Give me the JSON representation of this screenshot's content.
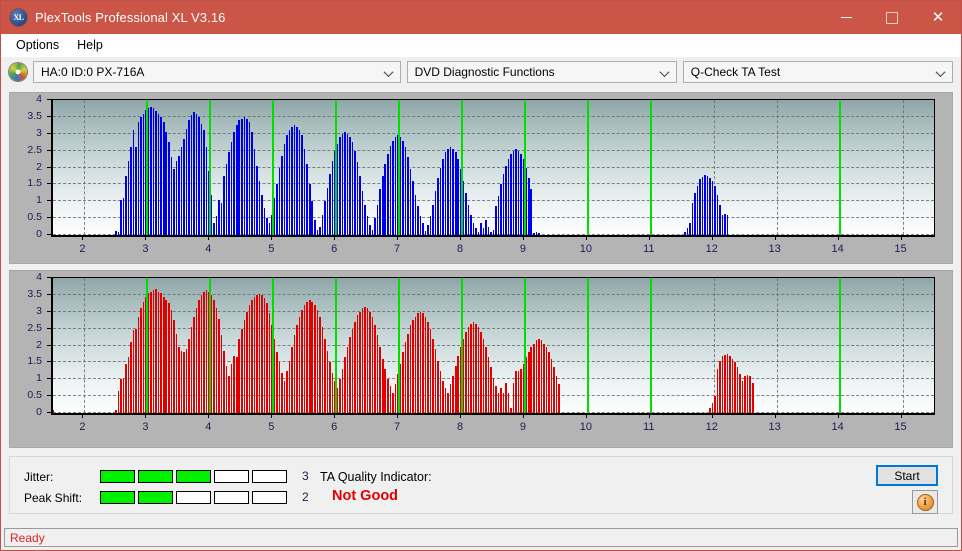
{
  "window": {
    "title": "PlexTools Professional XL V3.16",
    "app_icon": "XL",
    "minimize": "−",
    "maximize": "□",
    "close": "✕"
  },
  "menu": {
    "items": [
      {
        "label": "Options"
      },
      {
        "label": "Help"
      }
    ]
  },
  "toolbar": {
    "drive_icon": "disc-icon",
    "drive": "HA:0 ID:0  PX-716A",
    "function": "DVD Diagnostic Functions",
    "test": "Q-Check TA Test"
  },
  "status": {
    "jitter_label": "Jitter:",
    "jitter_value": "3",
    "jitter_filled": 3,
    "jitter_total": 5,
    "peak_shift_label": "Peak Shift:",
    "peak_shift_value": "2",
    "peak_shift_filled": 2,
    "peak_shift_total": 5,
    "ta_label": "TA Quality Indicator:",
    "ta_value": "Not Good",
    "start_label": "Start",
    "info_glyph": "i",
    "ready": "Ready"
  },
  "colors": {
    "titlebar": "#cb5647",
    "jitter_on": "#00f000",
    "ta_bad": "#e00000",
    "marker": "#00e000",
    "series_top": "#0000e6",
    "series_bottom": "#e00000",
    "accent": "#0078d7"
  },
  "chart_data": [
    {
      "type": "bar",
      "title": "",
      "series_name": "Jitter",
      "color": "#0000e6",
      "xlabel": "",
      "ylabel": "",
      "xlim": [
        1.5,
        15.5
      ],
      "ylim": [
        0,
        4
      ],
      "grid": true,
      "xticks": [
        2,
        3,
        4,
        5,
        6,
        7,
        8,
        9,
        10,
        11,
        12,
        13,
        14,
        15
      ],
      "yticks": [
        0,
        0.5,
        1,
        1.5,
        2,
        2.5,
        3,
        3.5,
        4
      ],
      "markers": [
        3,
        4,
        5,
        6,
        7,
        8,
        9,
        10,
        11,
        14
      ],
      "x_start": 1.5,
      "x_step": 0.04,
      "values": [
        0,
        0,
        0,
        0,
        0,
        0,
        0,
        0,
        0,
        0,
        0,
        0,
        0,
        0,
        0,
        0,
        0,
        0,
        0,
        0,
        0,
        0,
        0,
        0,
        0,
        0.12,
        0.1,
        1.05,
        1.1,
        1.75,
        2.2,
        2.6,
        3.1,
        2.6,
        3.35,
        3.5,
        3.6,
        3.7,
        3.75,
        3.78,
        3.75,
        3.68,
        3.6,
        3.5,
        3.35,
        3.05,
        2.75,
        2.3,
        1.95,
        2.2,
        2.35,
        2.6,
        2.85,
        3.15,
        3.4,
        3.55,
        3.65,
        3.6,
        3.5,
        3.3,
        3.1,
        2.6,
        1.9,
        1.2,
        0.35,
        0.55,
        1.05,
        0.95,
        1.75,
        2.1,
        2.45,
        2.75,
        3.05,
        3.25,
        3.4,
        3.45,
        3.5,
        3.45,
        3.35,
        3.05,
        2.55,
        2.05,
        1.6,
        1.2,
        0.8,
        0.5,
        0.35,
        0.6,
        1.1,
        1.5,
        2.0,
        2.35,
        2.7,
        2.95,
        3.1,
        3.2,
        3.25,
        3.2,
        3.1,
        2.95,
        2.55,
        2.1,
        1.5,
        1.0,
        0.45,
        0.15,
        0.25,
        0.6,
        1.0,
        1.4,
        1.8,
        2.2,
        2.5,
        2.7,
        2.9,
        3.0,
        3.05,
        3.0,
        2.9,
        2.75,
        2.5,
        2.15,
        1.75,
        1.3,
        0.9,
        0.55,
        0.3,
        0.15,
        0.5,
        0.9,
        1.35,
        1.75,
        2.1,
        2.4,
        2.65,
        2.8,
        2.9,
        2.95,
        2.9,
        2.8,
        2.6,
        2.3,
        1.95,
        1.6,
        1.2,
        0.85,
        0.55,
        0.35,
        0.12,
        0.3,
        0.55,
        0.9,
        1.3,
        1.7,
        2.0,
        2.25,
        2.45,
        2.55,
        2.6,
        2.55,
        2.45,
        2.25,
        1.95,
        1.6,
        1.25,
        0.9,
        0.6,
        0.35,
        0.2,
        0.1,
        0.35,
        0.2,
        0.45,
        0.25,
        0.1,
        0.15,
        0.85,
        1.15,
        1.5,
        1.8,
        2.05,
        2.25,
        2.4,
        2.5,
        2.55,
        2.5,
        2.4,
        2.25,
        2.0,
        1.7,
        1.35,
        0.05,
        0.08,
        0.06,
        0,
        0,
        0,
        0,
        0,
        0,
        0,
        0,
        0,
        0,
        0,
        0,
        0,
        0,
        0,
        0,
        0,
        0,
        0,
        0,
        0,
        0,
        0,
        0,
        0,
        0,
        0,
        0,
        0,
        0,
        0,
        0,
        0,
        0,
        0,
        0,
        0,
        0,
        0,
        0,
        0,
        0,
        0,
        0,
        0,
        0,
        0,
        0,
        0,
        0,
        0,
        0,
        0,
        0,
        0,
        0,
        0,
        0.1,
        0.2,
        0.35,
        0.95,
        1.25,
        1.45,
        1.65,
        1.72,
        1.78,
        1.74,
        1.68,
        1.6,
        1.45,
        1.2,
        0.9,
        0.6,
        0.62,
        0.6,
        0,
        0,
        0,
        0,
        0,
        0,
        0,
        0,
        0,
        0,
        0,
        0,
        0,
        0,
        0,
        0,
        0,
        0,
        0,
        0,
        0,
        0,
        0,
        0,
        0,
        0,
        0,
        0,
        0,
        0,
        0,
        0,
        0,
        0,
        0,
        0,
        0,
        0,
        0,
        0,
        0,
        0,
        0,
        0,
        0,
        0,
        0,
        0,
        0,
        0,
        0,
        0,
        0,
        0
      ]
    },
    {
      "type": "bar",
      "title": "",
      "series_name": "Peak Shift",
      "color": "#e00000",
      "xlabel": "",
      "ylabel": "",
      "xlim": [
        1.5,
        15.5
      ],
      "ylim": [
        0,
        4
      ],
      "grid": true,
      "xticks": [
        2,
        3,
        4,
        5,
        6,
        7,
        8,
        9,
        10,
        11,
        12,
        13,
        14,
        15
      ],
      "yticks": [
        0,
        0.5,
        1,
        1.5,
        2,
        2.5,
        3,
        3.5,
        4
      ],
      "markers": [
        3,
        4,
        5,
        6,
        7,
        8,
        9,
        10,
        11,
        14
      ],
      "x_start": 1.5,
      "x_step": 0.04,
      "values": [
        0.08,
        0,
        0,
        0,
        0,
        0,
        0,
        0,
        0,
        0,
        0,
        0,
        0,
        0,
        0,
        0,
        0,
        0,
        0,
        0,
        0,
        0,
        0,
        0,
        0,
        0.1,
        0.65,
        1.0,
        1.05,
        1.45,
        1.65,
        2.1,
        2.45,
        2.5,
        2.85,
        3.1,
        3.3,
        3.45,
        3.55,
        3.6,
        3.65,
        3.68,
        3.6,
        3.55,
        3.45,
        3.35,
        3.25,
        3.05,
        2.75,
        2.35,
        1.95,
        1.85,
        1.8,
        1.9,
        2.2,
        2.55,
        2.85,
        3.1,
        3.35,
        3.5,
        3.6,
        3.65,
        3.6,
        3.5,
        3.35,
        3.1,
        2.8,
        2.3,
        1.85,
        1.4,
        1.1,
        1.45,
        1.7,
        1.65,
        2.2,
        2.5,
        2.75,
        3.0,
        3.2,
        3.35,
        3.45,
        3.5,
        3.52,
        3.5,
        3.4,
        3.25,
        2.95,
        2.6,
        2.2,
        1.8,
        1.5,
        1.2,
        0.95,
        1.25,
        1.55,
        1.95,
        2.3,
        2.6,
        2.85,
        3.05,
        3.2,
        3.3,
        3.35,
        3.3,
        3.2,
        3.05,
        2.85,
        2.55,
        2.2,
        1.85,
        1.5,
        1.2,
        0.95,
        0.75,
        1.0,
        1.3,
        1.65,
        1.95,
        2.25,
        2.5,
        2.7,
        2.9,
        3.0,
        3.1,
        3.15,
        3.1,
        3.0,
        2.85,
        2.6,
        2.3,
        1.95,
        1.6,
        1.3,
        1.0,
        0.8,
        0.6,
        0.85,
        1.15,
        1.45,
        1.8,
        2.1,
        2.35,
        2.6,
        2.75,
        2.85,
        2.95,
        3.0,
        2.95,
        2.85,
        2.7,
        2.5,
        2.2,
        1.9,
        1.55,
        1.25,
        0.95,
        0.75,
        0.6,
        0.85,
        1.1,
        1.4,
        1.7,
        1.95,
        2.2,
        2.4,
        2.55,
        2.65,
        2.7,
        2.65,
        2.55,
        2.4,
        2.2,
        1.95,
        1.65,
        1.35,
        1.05,
        0.8,
        0.6,
        0.75,
        0.6,
        0.9,
        0.6,
        0.15,
        0.9,
        1.25,
        1.25,
        1.3,
        1.45,
        1.65,
        1.8,
        1.95,
        2.05,
        2.15,
        2.2,
        2.15,
        2.05,
        1.95,
        1.8,
        1.6,
        1.35,
        1.1,
        0.85,
        0,
        0,
        0,
        0,
        0,
        0,
        0,
        0,
        0,
        0,
        0,
        0,
        0,
        0,
        0,
        0,
        0,
        0,
        0,
        0,
        0,
        0,
        0,
        0,
        0,
        0,
        0,
        0,
        0,
        0,
        0,
        0,
        0,
        0,
        0,
        0,
        0,
        0,
        0,
        0,
        0,
        0,
        0,
        0,
        0,
        0,
        0,
        0,
        0,
        0,
        0,
        0,
        0,
        0,
        0,
        0,
        0,
        0,
        0,
        0.15,
        0.3,
        0.5,
        1.3,
        1.55,
        1.68,
        1.72,
        1.74,
        1.7,
        1.6,
        1.5,
        1.35,
        1.15,
        0.95,
        1.1,
        1.12,
        1.1,
        0.9,
        0,
        0,
        0,
        0,
        0,
        0,
        0,
        0,
        0,
        0,
        0,
        0,
        0,
        0,
        0,
        0,
        0,
        0,
        0,
        0,
        0,
        0,
        0,
        0,
        0,
        0,
        0,
        0,
        0,
        0,
        0,
        0,
        0,
        0,
        0,
        0,
        0,
        0,
        0,
        0,
        0,
        0,
        0,
        0,
        0,
        0,
        0,
        0,
        0,
        0,
        0,
        0,
        0,
        0
      ]
    }
  ]
}
